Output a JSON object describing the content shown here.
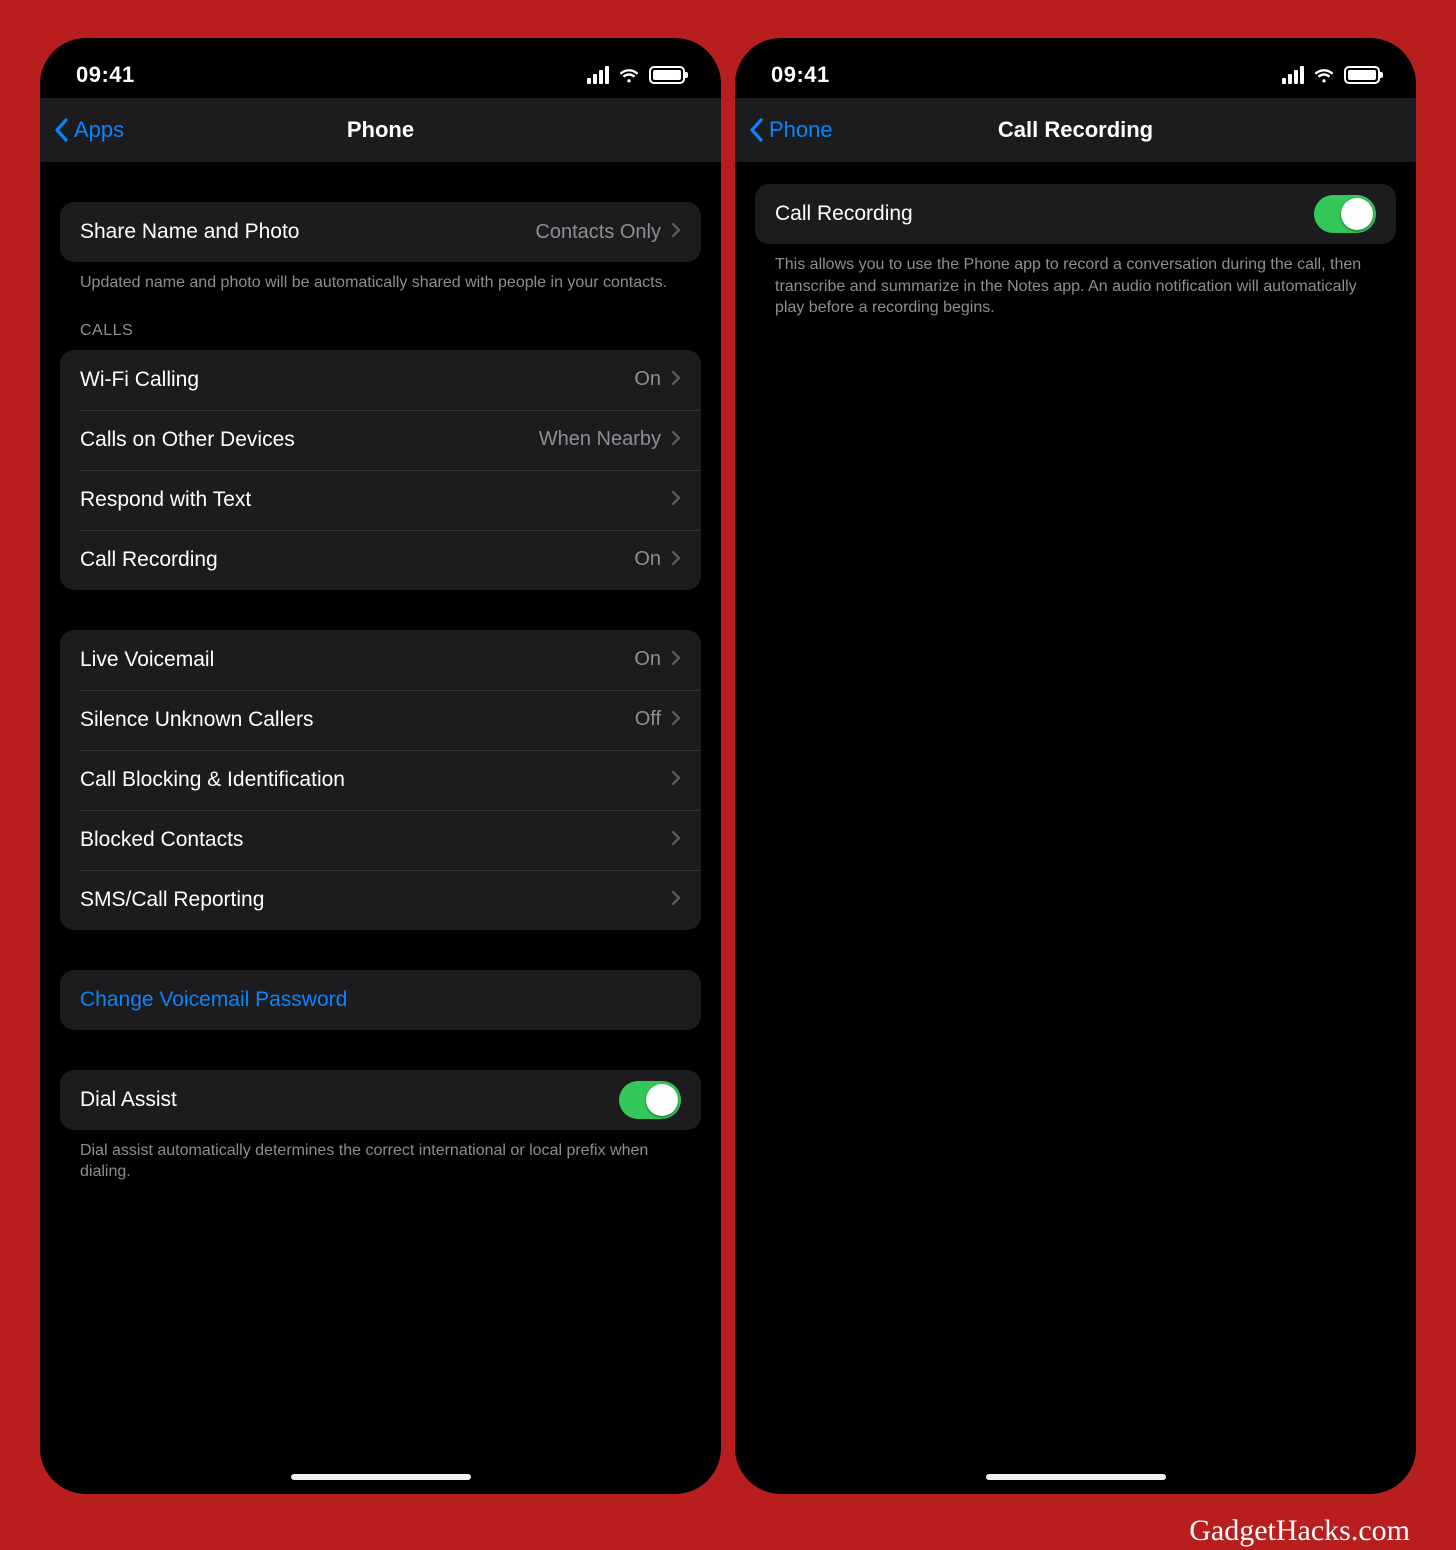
{
  "watermark": "GadgetHacks.com",
  "status": {
    "time": "09:41"
  },
  "left": {
    "back_label": "Apps",
    "title": "Phone",
    "share": {
      "label": "Share Name and Photo",
      "value": "Contacts Only",
      "footer": "Updated name and photo will be automatically shared with people in your contacts."
    },
    "calls_header": "CALLS",
    "calls": [
      {
        "label": "Wi-Fi Calling",
        "value": "On"
      },
      {
        "label": "Calls on Other Devices",
        "value": "When Nearby"
      },
      {
        "label": "Respond with Text",
        "value": ""
      },
      {
        "label": "Call Recording",
        "value": "On"
      }
    ],
    "other": [
      {
        "label": "Live Voicemail",
        "value": "On"
      },
      {
        "label": "Silence Unknown Callers",
        "value": "Off"
      },
      {
        "label": "Call Blocking & Identification",
        "value": ""
      },
      {
        "label": "Blocked Contacts",
        "value": ""
      },
      {
        "label": "SMS/Call Reporting",
        "value": ""
      }
    ],
    "voicemail_link": "Change Voicemail Password",
    "dial_assist": {
      "label": "Dial Assist",
      "on": true,
      "footer": "Dial assist automatically determines the correct international or local prefix when dialing."
    }
  },
  "right": {
    "back_label": "Phone",
    "title": "Call Recording",
    "row": {
      "label": "Call Recording",
      "on": true
    },
    "footer": "This allows you to use the Phone app to record a conversation during the call, then transcribe and summarize in the Notes app. An audio notification will automatically play before a recording begins."
  }
}
